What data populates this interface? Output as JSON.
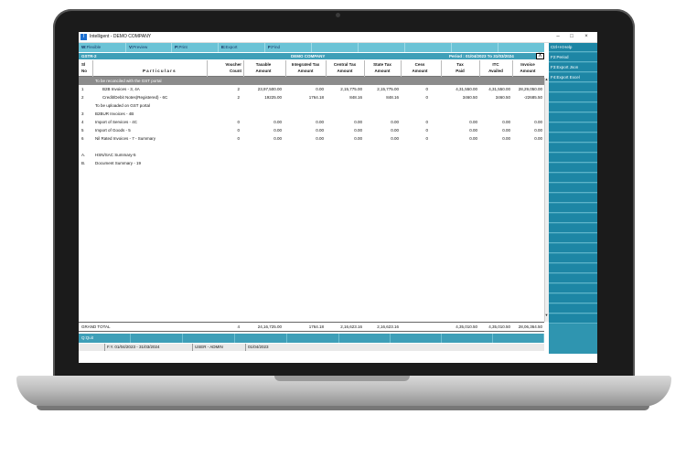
{
  "window": {
    "title": "Intelligent - DEMO COMPANY",
    "icon": "I",
    "minimize": "–",
    "maximize": "□",
    "close": "×"
  },
  "toolbar": [
    {
      "key": "W:",
      "label": "Flexible"
    },
    {
      "key": "V:",
      "label": "Preview"
    },
    {
      "key": "P:",
      "label": "Print"
    },
    {
      "key": "E:",
      "label": "Export"
    },
    {
      "key": "F:",
      "label": "Find"
    },
    {
      "key": "",
      "label": ""
    },
    {
      "key": "",
      "label": ""
    },
    {
      "key": "",
      "label": ""
    },
    {
      "key": "",
      "label": ""
    }
  ],
  "report": {
    "name": "GSTR-2",
    "company": "DEMO COMPANY",
    "period": "Period : 01/04/2023 To 31/03/2024",
    "close_label": "X"
  },
  "columns": {
    "sl": [
      "Sl",
      "No"
    ],
    "particulars": "P a r t i c u l a r s",
    "voucher": [
      "Voucher",
      "Count"
    ],
    "taxable": [
      "Taxable",
      "Amount"
    ],
    "igst": [
      "Integrated Tax",
      "Amount"
    ],
    "cgst": [
      "Central Tax",
      "Amount"
    ],
    "sgst": [
      "State Tax",
      "Amount"
    ],
    "cess": [
      "Cess",
      "Amount"
    ],
    "taxpaid": [
      "Tax",
      "Paid"
    ],
    "itc": [
      "ITC",
      "Availed"
    ],
    "invoice": [
      "Invoice",
      "Amount"
    ]
  },
  "rows": [
    {
      "type": "heading",
      "highlight": true,
      "sl": "",
      "particulars": "To be reconciled with the GST portal",
      "voucher": "",
      "taxable": "",
      "igst": "",
      "cgst": "",
      "sgst": "",
      "cess": "",
      "taxpaid": "",
      "itc": "",
      "invoice": ""
    },
    {
      "type": "data",
      "sl": "1",
      "particulars": "B2B Invoices - 3, 4A",
      "voucher": "2",
      "taxable": "23,97,500.00",
      "igst": "0.00",
      "cgst": "2,15,775.00",
      "sgst": "2,15,775.00",
      "cess": "0",
      "taxpaid": "4,31,550.00",
      "itc": "4,31,550.00",
      "invoice": "28,29,050.00"
    },
    {
      "type": "data",
      "sl": "2",
      "particulars": "Credit/Debit Notes(Registered) - 6C",
      "voucher": "2",
      "taxable": "19225.00",
      "igst": "1764.18",
      "cgst": "848.16",
      "sgst": "848.16",
      "cess": "0",
      "taxpaid": "3460.50",
      "itc": "3460.50",
      "invoice": "-22685.50"
    },
    {
      "type": "heading",
      "sl": "",
      "particulars": "To be uploaded on GST portal",
      "voucher": "",
      "taxable": "",
      "igst": "",
      "cgst": "",
      "sgst": "",
      "cess": "",
      "taxpaid": "",
      "itc": "",
      "invoice": ""
    },
    {
      "type": "data",
      "sl": "3",
      "particulars": "B2BUR Invoices - 4B",
      "voucher": "",
      "taxable": "",
      "igst": "",
      "cgst": "",
      "sgst": "",
      "cess": "",
      "taxpaid": "",
      "itc": "",
      "invoice": ""
    },
    {
      "type": "data",
      "sl": "4",
      "particulars": "Import of Services - 4C",
      "voucher": "0",
      "taxable": "0.00",
      "igst": "0.00",
      "cgst": "0.00",
      "sgst": "0.00",
      "cess": "0",
      "taxpaid": "0.00",
      "itc": "0.00",
      "invoice": "0.00"
    },
    {
      "type": "data",
      "sl": "5",
      "particulars": "Import of Goods - 5",
      "voucher": "0",
      "taxable": "0.00",
      "igst": "0.00",
      "cgst": "0.00",
      "sgst": "0.00",
      "cess": "0",
      "taxpaid": "0.00",
      "itc": "0.00",
      "invoice": "0.00"
    },
    {
      "type": "data",
      "sl": "6",
      "particulars": "Nil Rated Invoices - 7 - Summary",
      "voucher": "0",
      "taxable": "0.00",
      "igst": "0.00",
      "cgst": "0.00",
      "sgst": "0.00",
      "cess": "0",
      "taxpaid": "0.00",
      "itc": "0.00",
      "invoice": "0.00"
    },
    {
      "type": "blank",
      "sl": "",
      "particulars": "",
      "voucher": "",
      "taxable": "",
      "igst": "",
      "cgst": "",
      "sgst": "",
      "cess": "",
      "taxpaid": "",
      "itc": "",
      "invoice": ""
    },
    {
      "type": "data",
      "sl": "A.",
      "particulars": "HSN/SAC Summary-5",
      "voucher": "",
      "taxable": "",
      "igst": "",
      "cgst": "",
      "sgst": "",
      "cess": "",
      "taxpaid": "",
      "itc": "",
      "invoice": ""
    },
    {
      "type": "data",
      "sl": "B.",
      "particulars": "Document Summary - 19",
      "voucher": "",
      "taxable": "",
      "igst": "",
      "cgst": "",
      "sgst": "",
      "cess": "",
      "taxpaid": "",
      "itc": "",
      "invoice": ""
    }
  ],
  "grand_total": {
    "label": "GRAND  TOTAL",
    "voucher": "4",
    "taxable": "24,16,725.00",
    "igst": "1764.18",
    "cgst": "2,16,623.16",
    "sgst": "2,16,623.16",
    "taxpaid": "4,35,010.50",
    "itc": "4,35,010.50",
    "invoice": "28,06,364.50"
  },
  "bottom_bar": [
    {
      "label": "Q:Quit"
    },
    {
      "label": ""
    },
    {
      "label": ""
    },
    {
      "label": ""
    },
    {
      "label": ""
    },
    {
      "label": ""
    },
    {
      "label": ""
    },
    {
      "label": ""
    },
    {
      "label": ""
    }
  ],
  "status": {
    "fy": "F.Y. 01/04/2023 - 31/03/2024",
    "user": "USER - ADMIN",
    "date": "01/04/2023"
  },
  "right_panel": [
    {
      "label": "Ctrl+H:Help"
    },
    {
      "label": "F2:Period"
    },
    {
      "label": "F3:Export Json"
    },
    {
      "label": "F4:Export Excel"
    }
  ],
  "right_panel_empty_count": 24,
  "scroll": {
    "up": "▲",
    "down": "▼"
  }
}
